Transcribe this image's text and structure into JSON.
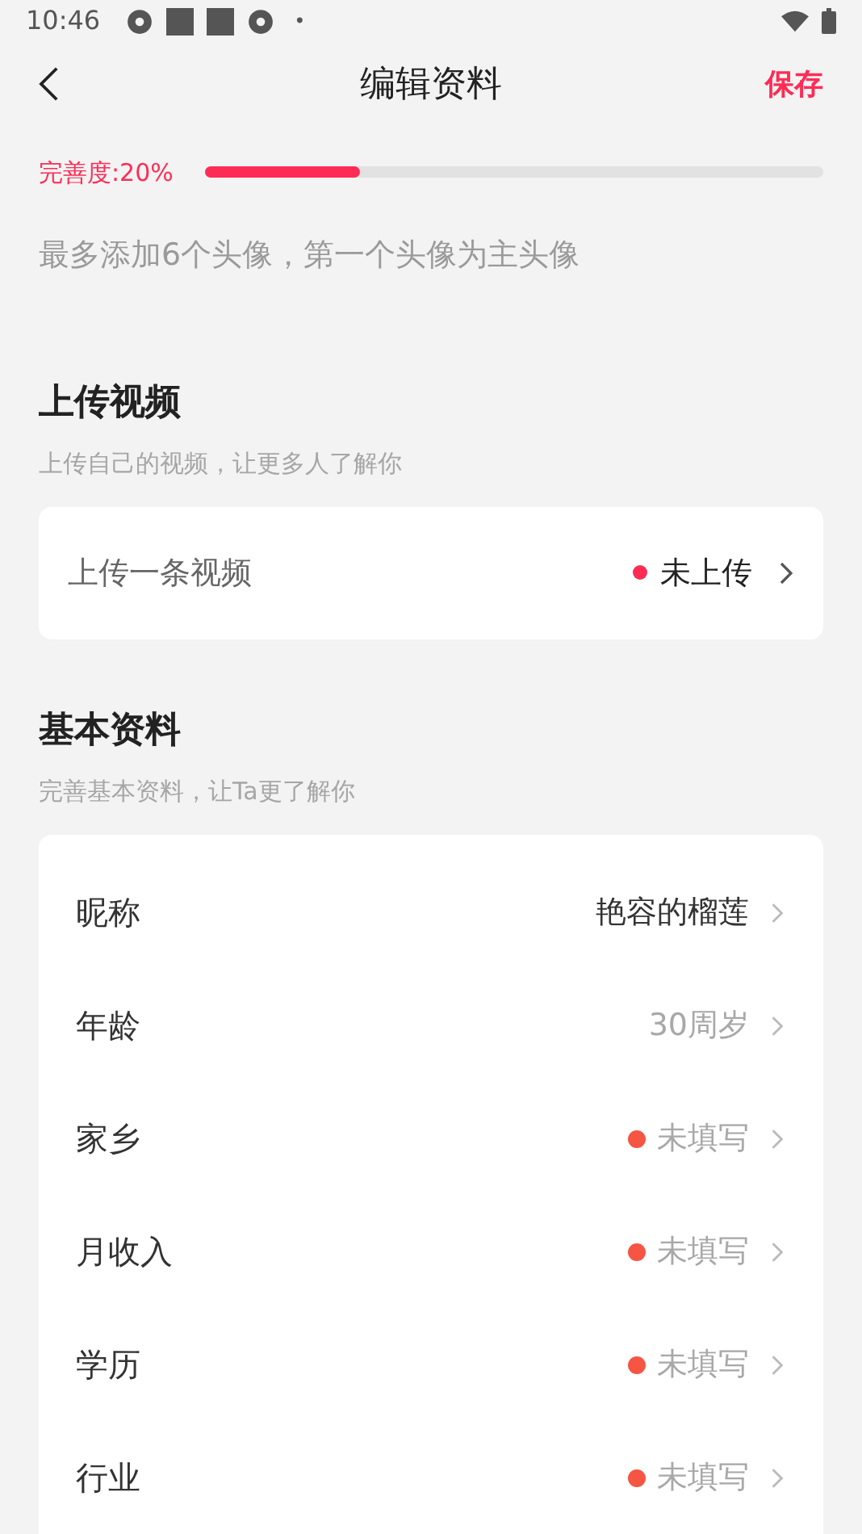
{
  "status_bar": {
    "time": "10:46",
    "dot": "•"
  },
  "header": {
    "title": "编辑资料",
    "save": "保存"
  },
  "completion": {
    "label": "完善度:20%",
    "level": 0.25
  },
  "avatar_hint": "最多添加6个头像，第一个头像为主头像",
  "video_section": {
    "title": "上传视频",
    "subtitle": "上传自己的视频，让更多人了解你",
    "row": {
      "label": "上传一条视频",
      "value": "未上传",
      "missing": true
    }
  },
  "basic_section": {
    "title": "基本资料",
    "subtitle": "完善基本资料，让Ta更了解你",
    "rows": [
      {
        "label": "昵称",
        "value": "艳容的榴莲",
        "missing": false,
        "muted": false
      },
      {
        "label": "年龄",
        "value": "30周岁",
        "missing": false,
        "muted": true
      },
      {
        "label": "家乡",
        "value": "未填写",
        "missing": true,
        "muted": true
      },
      {
        "label": "月收入",
        "value": "未填写",
        "missing": true,
        "muted": true
      },
      {
        "label": "学历",
        "value": "未填写",
        "missing": true,
        "muted": true
      },
      {
        "label": "行业",
        "value": "未填写",
        "missing": true,
        "muted": true
      }
    ]
  }
}
